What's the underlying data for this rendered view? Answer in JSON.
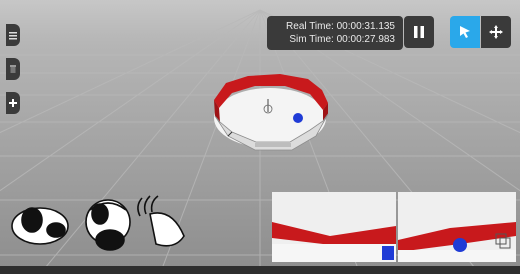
{
  "time": {
    "real_label": "Real Time:",
    "real_value": "00:00:31.135",
    "sim_label": "Sim Time:",
    "sim_value": "00:00:27.983"
  },
  "toolbar": {
    "pause_icon": "pause-icon",
    "select_icon": "cursor-icon",
    "move_icon": "move-icon"
  },
  "sidebar": {
    "items": [
      {
        "icon": "menu-icon"
      },
      {
        "icon": "trash-icon"
      },
      {
        "icon": "plus-icon"
      }
    ]
  },
  "colors": {
    "accent": "#2aa8ea",
    "arena_wall": "#c8191c",
    "ball": "#1f3bd6",
    "ground": "#9a9a9a"
  }
}
